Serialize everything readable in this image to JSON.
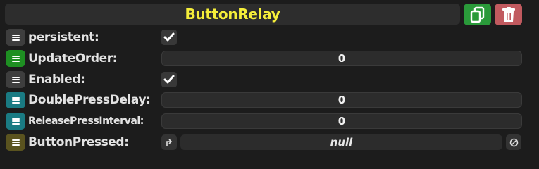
{
  "header": {
    "title": "ButtonRelay",
    "duplicate_icon": "duplicate-icon",
    "delete_icon": "trash-icon",
    "title_color": "#f5ee3a"
  },
  "fields": {
    "persistent": {
      "label": "persistent:",
      "checked": true
    },
    "update_order": {
      "label": "UpdateOrder:",
      "value": "0"
    },
    "enabled": {
      "label": "Enabled:",
      "checked": true
    },
    "double_press_delay": {
      "label": "DoublePressDelay:",
      "value": "0"
    },
    "release_press_interval": {
      "label": "ReleasePressInterval:",
      "value": "0"
    },
    "button_pressed": {
      "label": "ButtonPressed:",
      "value": "null"
    }
  }
}
